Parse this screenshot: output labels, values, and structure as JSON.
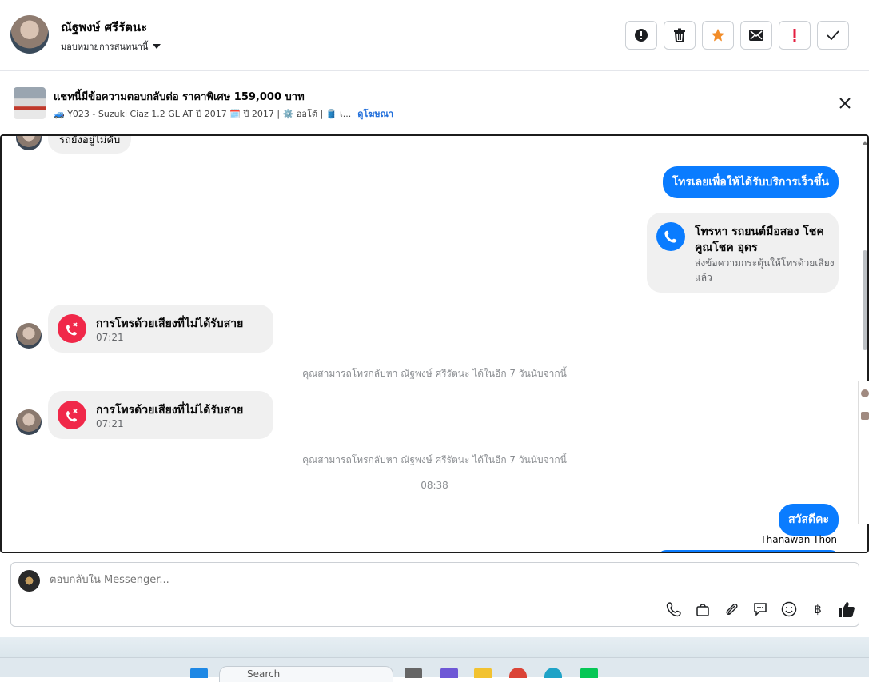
{
  "header": {
    "contact_name": "ณัฐพงษ์ ศรีรัตนะ",
    "assign_label": "มอบหมายการสนทนานี้",
    "actions": [
      {
        "name": "report-button",
        "icon": "exclamation-circle-icon"
      },
      {
        "name": "delete-button",
        "icon": "trash-icon"
      },
      {
        "name": "star-button",
        "icon": "star-icon"
      },
      {
        "name": "mark-unread-button",
        "icon": "envelope-icon"
      },
      {
        "name": "important-button",
        "icon": "exclamation-icon"
      },
      {
        "name": "done-button",
        "icon": "check-icon"
      }
    ],
    "accent_star": "#f28c28",
    "accent_important": "#e41e3f"
  },
  "listing": {
    "title": "แชทนี้มีข้อความตอบกลับต่อ ราคาพิเศษ 159,000 บาท",
    "subtitle": "🚙 Y023 - Suzuki Ciaz 1.2 GL AT ปี 2017 🗓️ ปี 2017 | ⚙️ ออโต้ | 🛢️ เ...",
    "ad_link": "ดูโฆษณา"
  },
  "conversation": {
    "msg_top_partial": "รถยังอยู่ไม่คับ",
    "out_msg_1": "โทรเลยเพื่อให้ได้รับบริการเร็วขึ้น",
    "call_card": {
      "title": "โทรหา รถยนต์มือสอง โชคคูณโชค อุดร",
      "subtitle": "ส่งข้อความกระตุ้นให้โทรด้วยเสียงแล้ว"
    },
    "missed_call_1": {
      "title": "การโทรด้วยเสียงที่ไม่ได้รับสาย",
      "time": "07:21"
    },
    "callback_note_1": "คุณสามารถโทรกลับหา ณัฐพงษ์ ศรีรัตนะ ได้ในอีก 7 วันนับจากนี้",
    "missed_call_2": {
      "title": "การโทรด้วยเสียงที่ไม่ได้รับสาย",
      "time": "07:21"
    },
    "callback_note_2": "คุณสามารถโทรกลับหา ณัฐพงษ์ ศรีรัตนะ ได้ในอีก 7 วันนับจากนี้",
    "timestamp": "08:38",
    "out_msg_2": "สวัสดีคะ",
    "sender_name": "Thanawan Thon",
    "colors": {
      "outgoing": "#0a7cff",
      "missed_call": "#f02849",
      "incoming_bg": "#f0f0f0"
    }
  },
  "composer": {
    "placeholder": "ตอบกลับใน Messenger...",
    "tools": [
      "phone-icon",
      "shopping-bag-icon",
      "paperclip-icon",
      "saved-reply-icon",
      "emoji-icon",
      "baht-icon",
      "thumbs-up-icon"
    ],
    "baht_symbol": "฿"
  },
  "taskbar": {
    "search_placeholder": "Search"
  }
}
